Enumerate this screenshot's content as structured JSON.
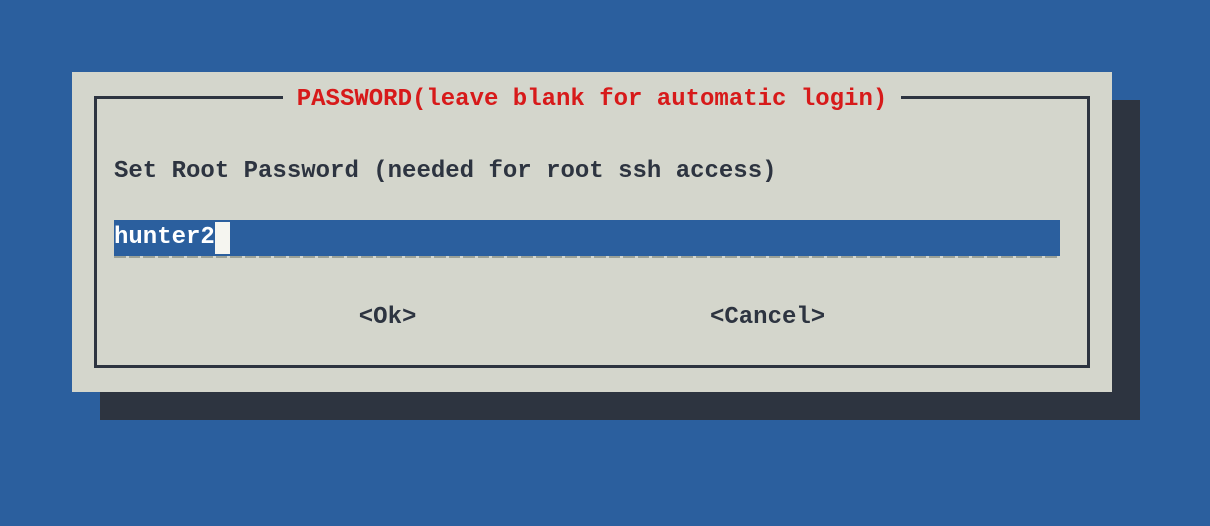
{
  "dialog": {
    "title": "PASSWORD(leave blank for automatic login)",
    "prompt": "Set Root Password (needed for root ssh access)",
    "input_value": "hunter2",
    "ok_label": "<Ok>",
    "cancel_label": "<Cancel>"
  },
  "colors": {
    "background": "#2b5f9e",
    "panel": "#d4d6cc",
    "shadow": "#2d3440",
    "title": "#d71a1a",
    "text": "#2d3440",
    "input_bg": "#2b5f9e",
    "input_fg": "#ffffff"
  }
}
